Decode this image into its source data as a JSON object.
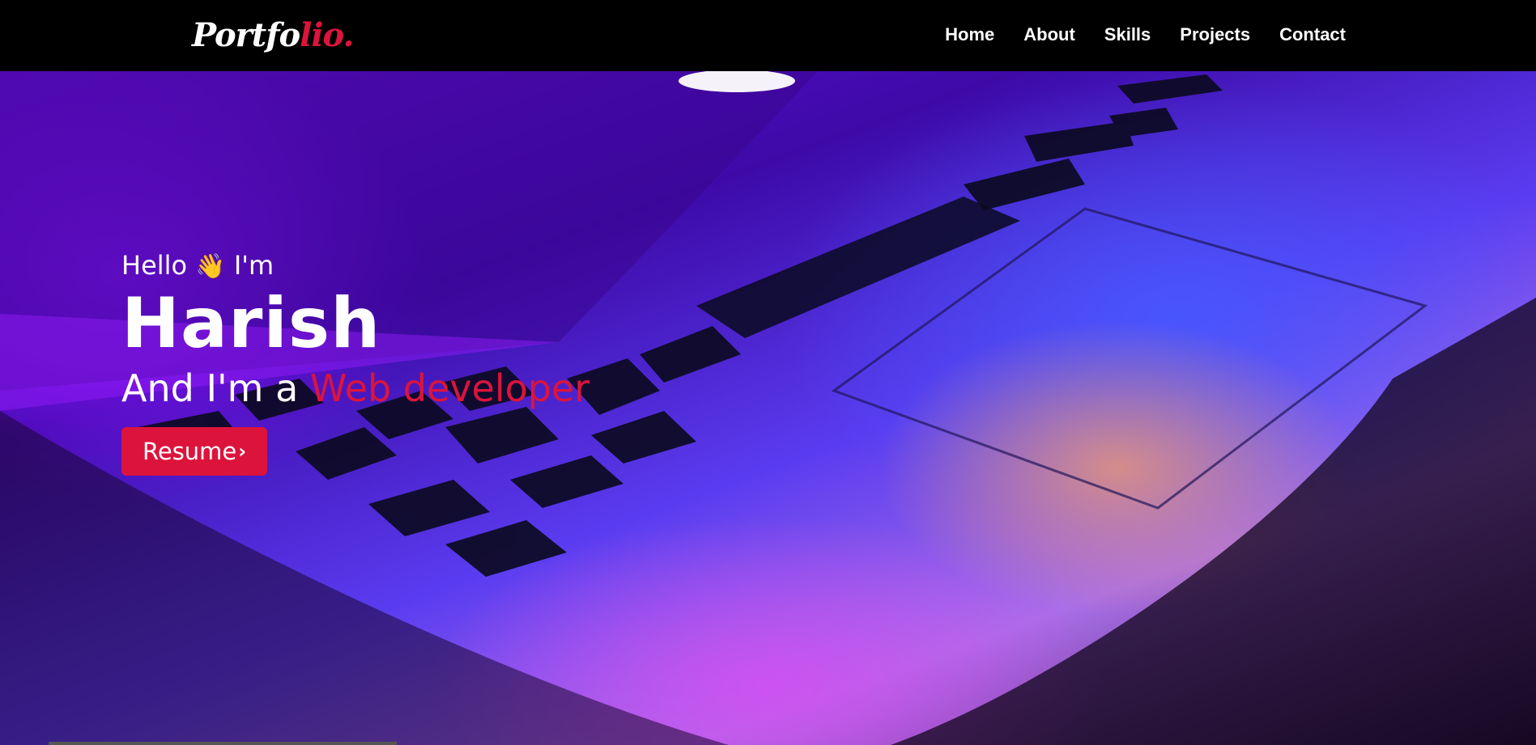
{
  "nav": {
    "logo_main": "Portfo",
    "logo_accent": "lio.",
    "links": [
      "Home",
      "About",
      "Skills",
      "Projects",
      "Contact"
    ]
  },
  "hero": {
    "greeting_before": "Hello",
    "wave_emoji": "👋",
    "greeting_after": "I'm",
    "name": "Harish",
    "role_prefix": "And I'm a",
    "role": "Web developer",
    "resume_label": "Resume",
    "resume_icon": "chevron-right-icon"
  },
  "colors": {
    "accent": "#dc143c",
    "nav_background": "#000000",
    "text": "#ffffff"
  }
}
